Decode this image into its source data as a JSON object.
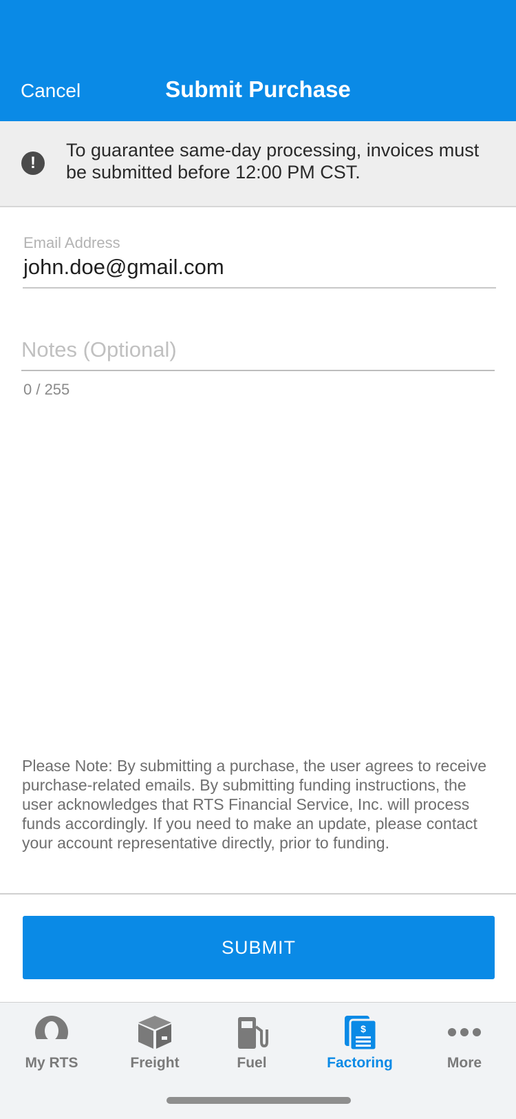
{
  "header": {
    "cancel_label": "Cancel",
    "title": "Submit Purchase"
  },
  "banner": {
    "icon": "exclamation-circle-icon",
    "text": "To guarantee same-day processing, invoices must be submitted before 12:00 PM CST."
  },
  "form": {
    "email_label": "Email Address",
    "email_value": "john.doe@gmail.com",
    "notes_placeholder": "Notes (Optional)",
    "notes_counter": "0 / 255"
  },
  "note": {
    "text": "Please Note: By submitting a purchase, the user agrees to receive purchase-related emails. By submitting funding instructions, the user acknowledges that RTS Financial Service, Inc. will process funds accordingly. If you need to make an update, please contact your account representative directly, prior to funding."
  },
  "submit_label": "SUBMIT",
  "tabs": [
    {
      "label": "My RTS",
      "icon": "user-icon",
      "active": false
    },
    {
      "label": "Freight",
      "icon": "box-icon",
      "active": false
    },
    {
      "label": "Fuel",
      "icon": "fuel-pump-icon",
      "active": false
    },
    {
      "label": "Factoring",
      "icon": "invoice-dollar-icon",
      "active": true
    },
    {
      "label": "More",
      "icon": "ellipsis-icon",
      "active": false
    }
  ],
  "colors": {
    "accent": "#0a8ae6",
    "tab_inactive": "#7a7a7a",
    "banner_bg": "#eeeeee"
  }
}
